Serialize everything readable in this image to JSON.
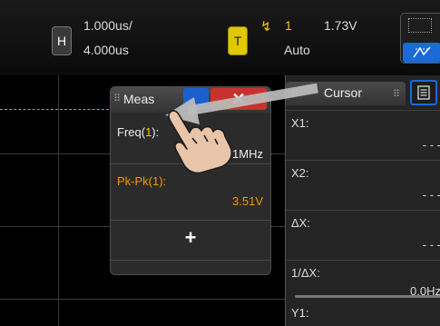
{
  "timebase": {
    "badge": "H",
    "scale": "1.000us/",
    "delay": "4.000us"
  },
  "trigger": {
    "badge": "T",
    "edge_symbol": "↯",
    "source": "1",
    "level": "1.73V",
    "mode": "Auto"
  },
  "auto_scale": {
    "icon": "auto-scale-icon",
    "glyph": "⩜̸"
  },
  "meas_panel": {
    "title": "Meas",
    "close": "✕",
    "rows": [
      {
        "label": "Freq(",
        "channel": "1",
        "label_end": "):",
        "value": "3.851MHz"
      },
      {
        "label": "Pk-Pk(1):",
        "value": "3.51V"
      }
    ],
    "add": "+"
  },
  "cursor_panel": {
    "title": "Cursor",
    "rows": [
      {
        "label": "X1:",
        "value": "- - -"
      },
      {
        "label": "X2:",
        "value": "- - -"
      },
      {
        "label": "ΔX:",
        "value": "- - -"
      },
      {
        "label": "1/ΔX:",
        "value": "0.0Hz"
      },
      {
        "label": "Y1:",
        "value": ""
      }
    ]
  },
  "colors": {
    "trigger_yellow": "#e0c800",
    "measure_orange": "#f09a00",
    "channel_yellow": "#f0d000",
    "close_red": "#c8322e",
    "accent_blue": "#1a6ad8"
  }
}
